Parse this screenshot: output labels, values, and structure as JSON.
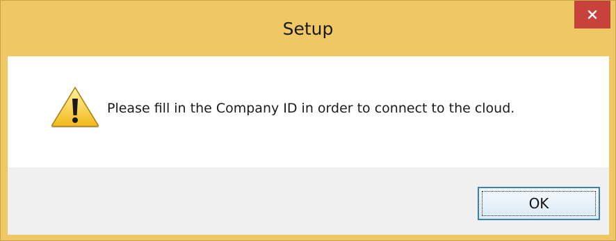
{
  "dialog": {
    "title": "Setup",
    "message": "Please fill in the Company ID in order to connect to the cloud.",
    "icon": "warning-icon",
    "ok_label": "OK",
    "close_icon": "close-icon"
  },
  "colors": {
    "titlebar": "#f0c765",
    "close_button": "#c7423a",
    "button_area": "#f0f0f0",
    "ok_border": "#3c7fb1"
  }
}
